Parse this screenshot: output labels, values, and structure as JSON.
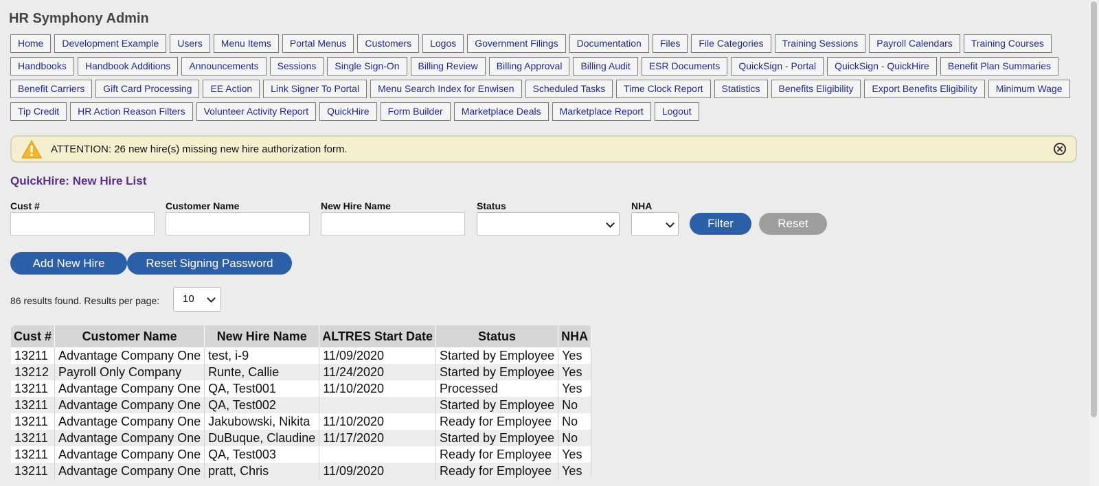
{
  "app_title": "HR Symphony Admin",
  "nav_rows": [
    [
      "Home",
      "Development Example",
      "Users",
      "Menu Items",
      "Portal Menus",
      "Customers",
      "Logos",
      "Government Filings",
      "Documentation",
      "Files",
      "File Categories",
      "Training Sessions",
      "Payroll Calendars",
      "Training Courses"
    ],
    [
      "Handbooks",
      "Handbook Additions",
      "Announcements",
      "Sessions",
      "Single Sign-On",
      "Billing Review",
      "Billing Approval",
      "Billing Audit",
      "ESR Documents",
      "QuickSign - Portal",
      "QuickSign - QuickHire",
      "Benefit Plan Summaries"
    ],
    [
      "Benefit Carriers",
      "Gift Card Processing",
      "EE Action",
      "Link Signer To Portal",
      "Menu Search Index for Enwisen",
      "Scheduled Tasks",
      "Time Clock Report",
      "Statistics",
      "Benefits Eligibility",
      "Export Benefits Eligibility",
      "Minimum Wage"
    ],
    [
      "Tip Credit",
      "HR Action Reason Filters",
      "Volunteer Activity Report",
      "QuickHire",
      "Form Builder",
      "Marketplace Deals",
      "Marketplace Report",
      "Logout"
    ]
  ],
  "alert": {
    "text": "ATTENTION: 26 new hire(s) missing new hire authorization form.",
    "icon": "warning-icon",
    "color": "#f4f0cf"
  },
  "page_heading": "QuickHire: New Hire List",
  "filters": {
    "cust_label": "Cust #",
    "customer_name_label": "Customer Name",
    "new_hire_name_label": "New Hire Name",
    "status_label": "Status",
    "nha_label": "NHA",
    "cust_value": "",
    "customer_name_value": "",
    "new_hire_name_value": "",
    "status_value": "",
    "nha_value": "",
    "filter_button": "Filter",
    "reset_button": "Reset"
  },
  "actions": {
    "add_new_hire": "Add New Hire",
    "reset_signing_password": "Reset Signing Password"
  },
  "results": {
    "text": "86 results found. Results per page:",
    "per_page": "10"
  },
  "table": {
    "headers": [
      "Cust #",
      "Customer Name",
      "New Hire Name",
      "ALTRES Start Date",
      "Status",
      "NHA"
    ],
    "rows": [
      [
        "13211",
        "Advantage Company One",
        "test, i-9",
        "11/09/2020",
        "Started by Employee",
        "Yes"
      ],
      [
        "13212",
        "Payroll Only Company",
        "Runte, Callie",
        "11/24/2020",
        "Started by Employee",
        "Yes"
      ],
      [
        "13211",
        "Advantage Company One",
        "QA, Test001",
        "11/10/2020",
        "Processed",
        "Yes"
      ],
      [
        "13211",
        "Advantage Company One",
        "QA, Test002",
        "",
        "Started by Employee",
        "No"
      ],
      [
        "13211",
        "Advantage Company One",
        "Jakubowski, Nikita",
        "11/10/2020",
        "Ready for Employee",
        "No"
      ],
      [
        "13211",
        "Advantage Company One",
        "DuBuque, Claudine",
        "11/17/2020",
        "Started by Employee",
        "No"
      ],
      [
        "13211",
        "Advantage Company One",
        "QA, Test003",
        "",
        "Ready for Employee",
        "Yes"
      ],
      [
        "13211",
        "Advantage Company One",
        "pratt, Chris",
        "11/09/2020",
        "Ready for Employee",
        "Yes"
      ]
    ]
  },
  "colors": {
    "nav_text": "#1f2b8c",
    "heading": "#5a2d86",
    "primary_button": "#2b5fa8",
    "secondary_button": "#9e9e9e"
  }
}
